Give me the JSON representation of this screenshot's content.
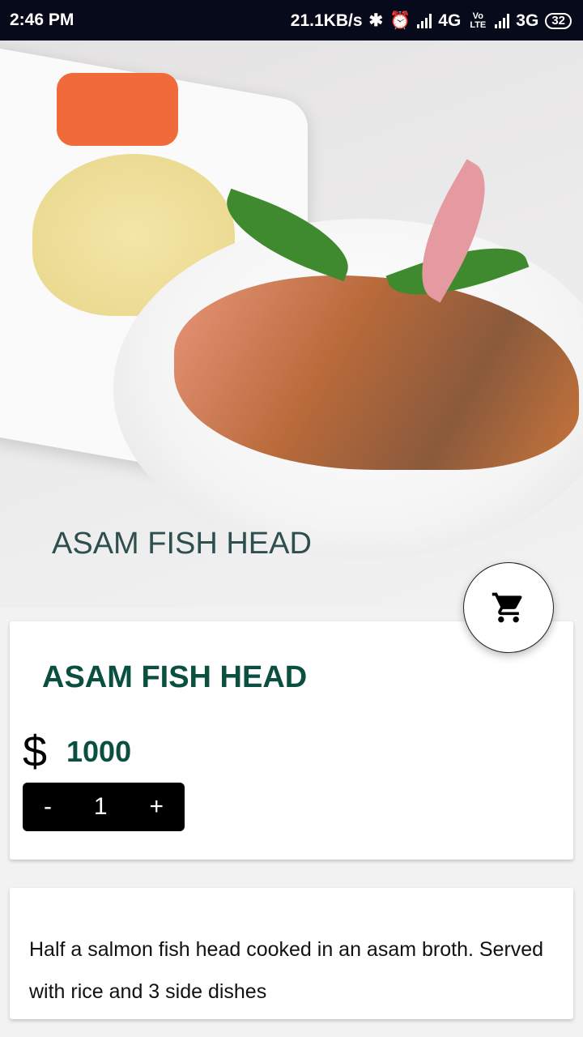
{
  "status_bar": {
    "time": "2:46 PM",
    "net_speed": "21.1KB/s",
    "network1": "4G",
    "volte": "Vo LTE",
    "network2": "3G",
    "battery": "32"
  },
  "hero": {
    "title": "ASAM FISH HEAD",
    "image": "asam fish head dish photo"
  },
  "product": {
    "name": "ASAM FISH HEAD",
    "currency": "$",
    "price": "1000",
    "quantity": "1",
    "minus_label": "-",
    "plus_label": "+"
  },
  "description": "Half a salmon fish head cooked in an asam broth. Served with rice and 3 side dishes",
  "cart_button": {
    "icon": "cart-icon"
  },
  "colors": {
    "accent": "#0a4f3f",
    "hero_title": "#2f4f4f"
  }
}
